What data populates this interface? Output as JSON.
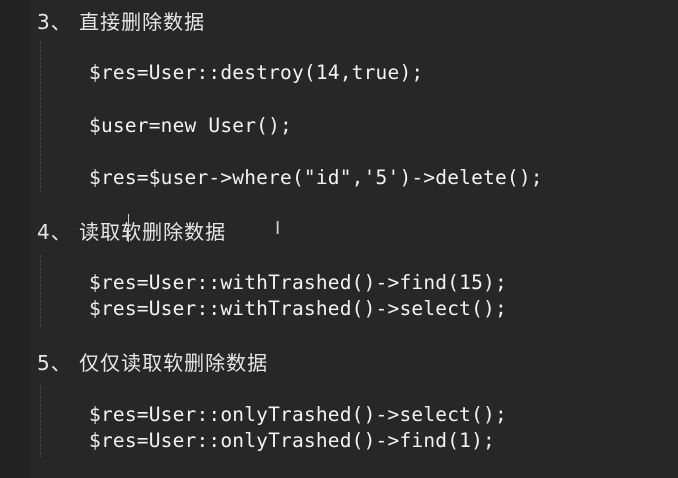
{
  "editor": {
    "sections": [
      {
        "heading": "3、 直接删除数据",
        "lines": [
          "$res=User::destroy(14,true);",
          "$user=new User();",
          "$res=$user->where(\"id\",'5')->delete();"
        ]
      },
      {
        "heading": "4、 读取软删除数据",
        "lines": [
          "$res=User::withTrashed()->find(15);",
          "$res=User::withTrashed()->select();"
        ]
      },
      {
        "heading": "5、 仅仅读取软删除数据",
        "lines": [
          "$res=User::onlyTrashed()->select();",
          "$res=User::onlyTrashed()->find(1);"
        ]
      }
    ],
    "cursor_glyph": "I"
  }
}
